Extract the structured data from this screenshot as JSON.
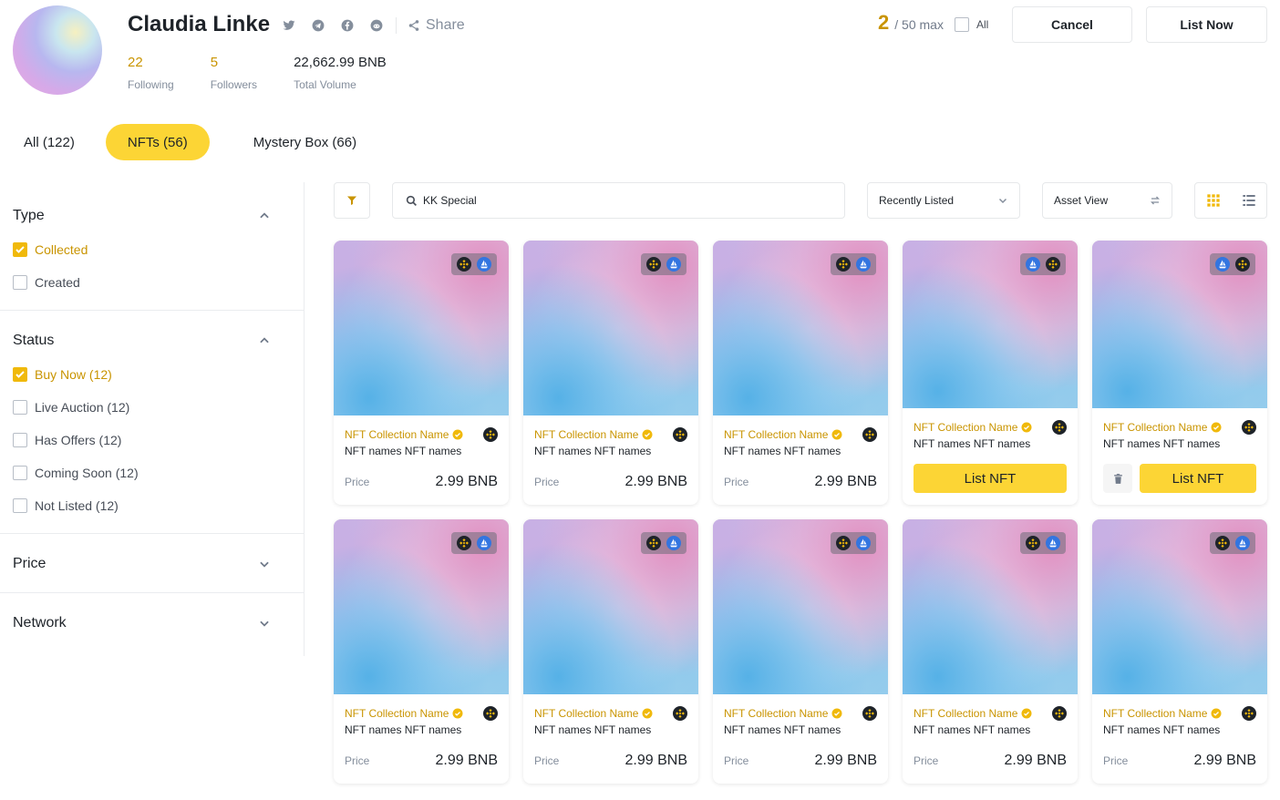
{
  "profile": {
    "name": "Claudia Linke",
    "share_label": "Share",
    "stats": [
      {
        "value": "22",
        "label": "Following"
      },
      {
        "value": "5",
        "label": "Followers"
      },
      {
        "value": "22,662.99 BNB",
        "label": "Total Volume"
      }
    ]
  },
  "selection": {
    "count": "2",
    "max_text": "/ 50 max",
    "all_label": "All",
    "cancel_label": "Cancel",
    "list_now_label": "List Now"
  },
  "tabs": [
    {
      "label": "All (122)",
      "active": false
    },
    {
      "label": "NFTs (56)",
      "active": true
    },
    {
      "label": "Mystery Box (66)",
      "active": false
    }
  ],
  "filters": {
    "type": {
      "title": "Type",
      "options": [
        {
          "label": "Collected",
          "checked": true
        },
        {
          "label": "Created",
          "checked": false
        }
      ]
    },
    "status": {
      "title": "Status",
      "options": [
        {
          "label": "Buy Now (12)",
          "checked": true
        },
        {
          "label": "Live Auction (12)",
          "checked": false
        },
        {
          "label": "Has Offers (12)",
          "checked": false
        },
        {
          "label": "Coming Soon (12)",
          "checked": false
        },
        {
          "label": "Not Listed (12)",
          "checked": false
        }
      ]
    },
    "price": {
      "title": "Price"
    },
    "network": {
      "title": "Network"
    }
  },
  "toolbar": {
    "search_value": "KK Special",
    "sort_value": "Recently Listed",
    "view_value": "Asset View"
  },
  "cards": [
    {
      "collection": "NFT Collection Name",
      "name": "NFT names NFT names",
      "price_label": "Price",
      "price": "2.99 BNB",
      "mode": "price",
      "chip": "bnb-first"
    },
    {
      "collection": "NFT Collection Name",
      "name": "NFT names NFT names",
      "price_label": "Price",
      "price": "2.99 BNB",
      "mode": "price",
      "chip": "bnb-first"
    },
    {
      "collection": "NFT Collection Name",
      "name": "NFT names NFT names",
      "price_label": "Price",
      "price": "2.99 BNB",
      "mode": "price",
      "chip": "bnb-first"
    },
    {
      "collection": "NFT Collection Name",
      "name": "NFT names NFT names",
      "button": "List NFT",
      "mode": "list",
      "chip": "ship-first"
    },
    {
      "collection": "NFT Collection Name",
      "name": "NFT names NFT names",
      "button": "List NFT",
      "mode": "list-delete",
      "chip": "ship-first"
    },
    {
      "collection": "NFT Collection Name",
      "name": "NFT names NFT names",
      "price_label": "Price",
      "price": "2.99 BNB",
      "mode": "price",
      "chip": "bnb-first"
    },
    {
      "collection": "NFT Collection Name",
      "name": "NFT names NFT names",
      "price_label": "Price",
      "price": "2.99 BNB",
      "mode": "price",
      "chip": "bnb-first"
    },
    {
      "collection": "NFT Collection Name",
      "name": "NFT names NFT names",
      "price_label": "Price",
      "price": "2.99 BNB",
      "mode": "price",
      "chip": "bnb-first"
    },
    {
      "collection": "NFT Collection Name",
      "name": "NFT names NFT names",
      "price_label": "Price",
      "price": "2.99 BNB",
      "mode": "price",
      "chip": "bnb-first"
    },
    {
      "collection": "NFT Collection Name",
      "name": "NFT names NFT names",
      "price_label": "Price",
      "price": "2.99 BNB",
      "mode": "price",
      "chip": "bnb-first"
    }
  ],
  "colors": {
    "accent": "#fcd535",
    "accent_text": "#c99400",
    "text": "#1e2329",
    "muted": "#848e9c"
  },
  "icons": {
    "social": [
      "twitter-icon",
      "telegram-icon",
      "facebook-icon",
      "reddit-icon"
    ],
    "share": "share-icon",
    "filter": "funnel-icon",
    "search": "search-icon",
    "view_grid": "grid-icon",
    "view_list": "list-icon"
  }
}
